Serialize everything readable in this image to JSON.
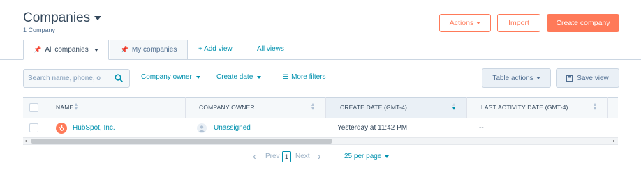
{
  "header": {
    "title": "Companies",
    "subtitle": "1 Company",
    "actions_label": "Actions",
    "import_label": "Import",
    "create_label": "Create company"
  },
  "tabs": [
    {
      "label": "All companies"
    },
    {
      "label": "My companies"
    }
  ],
  "add_view_label": "+ Add view",
  "all_views_label": "All views",
  "search": {
    "placeholder": "Search name, phone, o"
  },
  "filters": {
    "company_owner": "Company owner",
    "create_date": "Create date",
    "more_filters": "More filters"
  },
  "table_actions_label": "Table actions",
  "save_view_label": "Save view",
  "table": {
    "columns": [
      "NAME",
      "COMPANY OWNER",
      "CREATE DATE (GMT-4)",
      "LAST ACTIVITY DATE (GMT-4)"
    ],
    "rows": [
      {
        "name": "HubSpot, Inc.",
        "owner": "Unassigned",
        "create_date": "Yesterday at 11:42 PM",
        "last_activity": "--"
      }
    ]
  },
  "pagination": {
    "prev": "Prev",
    "page": "1",
    "next": "Next",
    "per_page": "25 per page"
  },
  "colors": {
    "accent": "#ff7a59",
    "link": "#0091ae",
    "text": "#33475b",
    "border": "#cbd6e2"
  },
  "icons": [
    "caret-down-icon",
    "pin-icon",
    "search-icon",
    "filter-icon",
    "save-icon",
    "sort-icon",
    "hubspot-logo-icon",
    "avatar-icon",
    "chevron-left-icon",
    "chevron-right-icon",
    "scroll-left-icon",
    "scroll-right-icon"
  ]
}
